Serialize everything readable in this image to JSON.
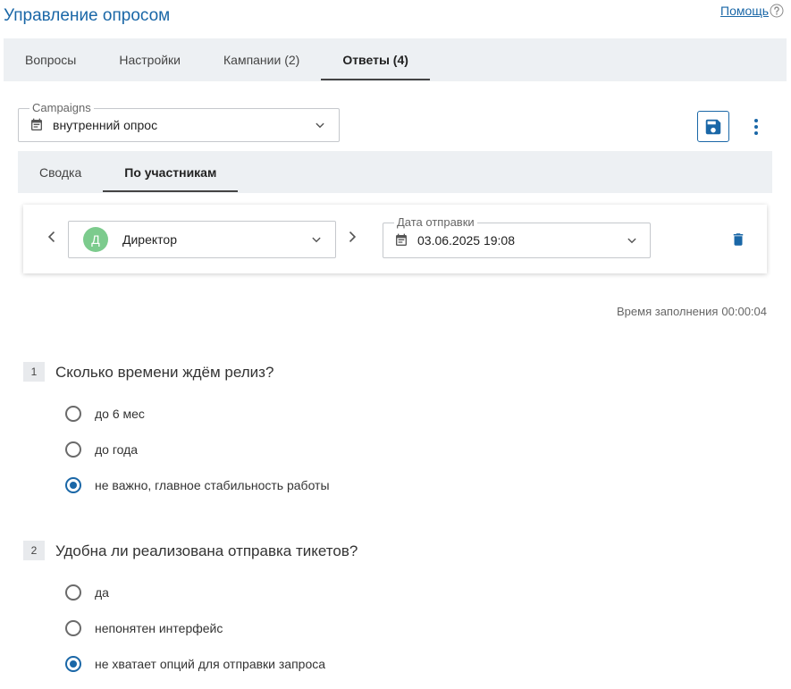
{
  "header": {
    "title": "Управление опросом",
    "help_label": "Помощь",
    "help_icon": "help-circle-icon"
  },
  "theme": {
    "accent": "#1a67a7",
    "tab_bar_bg": "#edf0f3",
    "avatar_bg": "#7ccb8d"
  },
  "tabs": [
    {
      "label": "Вопросы",
      "active": false
    },
    {
      "label": "Настройки",
      "active": false
    },
    {
      "label": "Кампании (2)",
      "active": false
    },
    {
      "label": "Ответы (4)",
      "active": true
    }
  ],
  "campaign_select": {
    "label": "Campaigns",
    "value": "внутренний опрос",
    "icon": "calendar-icon"
  },
  "actions": {
    "save_icon": "save-icon",
    "more_icon": "more-vertical-icon"
  },
  "subtabs": [
    {
      "label": "Сводка",
      "active": false
    },
    {
      "label": "По участникам",
      "active": true
    }
  ],
  "respondent": {
    "prev_icon": "chevron-left-icon",
    "next_icon": "chevron-right-icon",
    "avatar_letter": "Д",
    "name": "Директор",
    "date_label": "Дата отправки",
    "date_value": "03.06.2025 19:08",
    "delete_icon": "trash-icon"
  },
  "fill_time": {
    "label": "Время заполнения",
    "value": "00:00:04"
  },
  "questions": [
    {
      "number": "1",
      "text": "Сколько времени ждём релиз?",
      "options": [
        {
          "label": "до 6 мес",
          "checked": false
        },
        {
          "label": "до года",
          "checked": false
        },
        {
          "label": "не важно, главное стабильность работы",
          "checked": true
        }
      ]
    },
    {
      "number": "2",
      "text": "Удобна ли реализована отправка тикетов?",
      "options": [
        {
          "label": "да",
          "checked": false
        },
        {
          "label": "непонятен интерфейс",
          "checked": false
        },
        {
          "label": "не хватает опций для отправки запроса",
          "checked": true
        }
      ]
    }
  ]
}
